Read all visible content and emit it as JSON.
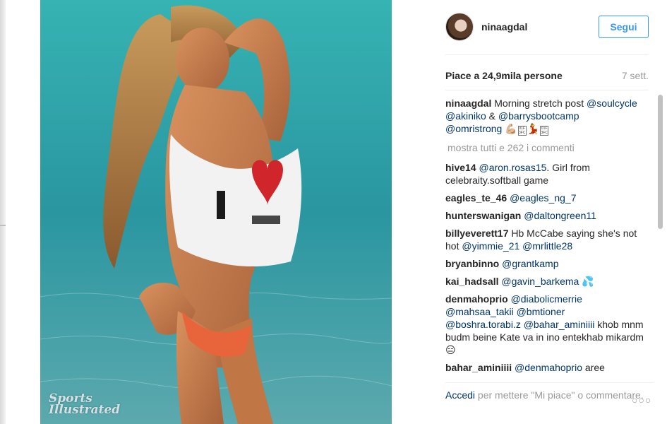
{
  "post": {
    "username": "ninaagdal",
    "follow_label": "Segui",
    "likes_text": "Piace a 24,9mila persone",
    "age_text": "7 sett.",
    "photo_watermark_lines": [
      "Sports",
      "Illustrated"
    ]
  },
  "caption": {
    "username": "ninaagdal",
    "text": " Morning stretch post ",
    "mentions": [
      "@soulcycle",
      "@akiniko",
      "@barrysbootcamp",
      "@omristrong"
    ],
    "joiner_1": " ",
    "joiner_2": " & ",
    "joiner_3": " "
  },
  "show_all_comments": "mostra tutti e 262 i commenti",
  "comments": [
    {
      "username": "hive14",
      "mention": "@aron.rosas15",
      "text": ". Girl from celebraity.softball game"
    },
    {
      "username": "eagles_te_46",
      "mention": "@eagles_ng_7",
      "text": ""
    },
    {
      "username": "hunterswanigan",
      "mention": "@daltongreen11",
      "text": ""
    },
    {
      "username": "billyeverett17",
      "text1": " Hb McCabe saying she's not hot ",
      "mention1": "@yimmie_21",
      "mention2": "@mrlittle28"
    },
    {
      "username": "bryanbinno",
      "mention": "@grantkamp",
      "text": ""
    },
    {
      "username": "kai_hadsall",
      "mention": "@gavin_barkema",
      "emoji": "💦"
    },
    {
      "username": "denmahoprio",
      "mention1": "@diabolicmerrie",
      "mention2": "@mahsaa_takii",
      "mention3": "@bmtioner",
      "mention4": "@boshra.torabi.z",
      "mention5": "@bahar_aminiiii",
      "text": " khob mnm budm beine Kate va in ino entekhab mikardm",
      "emoji": "😑"
    },
    {
      "username": "bahar_aminiiii",
      "mention": "@denmahoprio",
      "text": " aree mishnam inee nina khube"
    }
  ],
  "footer": {
    "login_link": "Accedi",
    "rest": " per mettere \"Mi piace\" o commentare.",
    "more_icon": "more-dots-icon"
  },
  "colors": {
    "accent": "#3897f0",
    "mention": "#003569",
    "muted": "#999999"
  }
}
